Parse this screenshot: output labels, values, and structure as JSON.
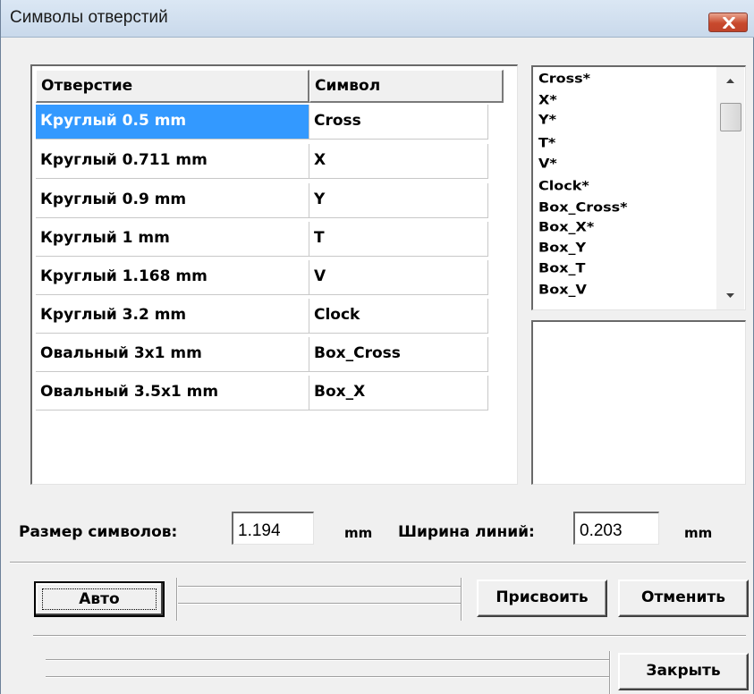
{
  "window": {
    "title": "Символы отверстий",
    "close_icon": "close-x-icon"
  },
  "table": {
    "columns": [
      "Отверстие",
      "Символ"
    ],
    "rows": [
      {
        "hole": "Круглый 0.5 mm",
        "symbol": "Cross",
        "selected": true
      },
      {
        "hole": "Круглый 0.711 mm",
        "symbol": "X"
      },
      {
        "hole": "Круглый 0.9 mm",
        "symbol": "Y"
      },
      {
        "hole": "Круглый 1 mm",
        "symbol": "T"
      },
      {
        "hole": "Круглый 1.168 mm",
        "symbol": "V"
      },
      {
        "hole": "Круглый 3.2 mm",
        "symbol": "Clock"
      },
      {
        "hole": "Овальный 3x1 mm",
        "symbol": "Box_Cross"
      },
      {
        "hole": "Овальный 3.5x1 mm",
        "symbol": "Box_X"
      }
    ]
  },
  "symbol_list": {
    "items": [
      "Cross*",
      "X*",
      "Y*",
      "T*",
      "V*",
      "Clock*",
      "Box_Cross*",
      "Box_X*",
      "Box_Y",
      "Box_T",
      "Box_V"
    ],
    "scroll_up_icon": "scroll-up-arrow-icon",
    "scroll_down_icon": "scroll-down-arrow-icon"
  },
  "sizes": {
    "symbol_size_label": "Размер символов:",
    "symbol_size_value": "1.194",
    "symbol_size_unit": "mm",
    "line_width_label": "Ширина линий:",
    "line_width_value": "0.203",
    "line_width_unit": "mm"
  },
  "buttons": {
    "auto": "Авто",
    "assign": "Присвоить",
    "cancel": "Отменить",
    "close": "Закрыть"
  },
  "colors": {
    "selection": "#3399ff",
    "close_button": "#c8492d"
  }
}
